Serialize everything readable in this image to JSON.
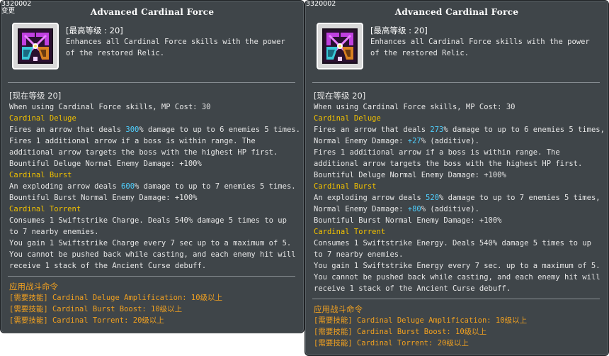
{
  "colors": {
    "panel_bg": "#3f4549",
    "text": "#e6e6e6",
    "section_heading": "#f0c000",
    "highlight_value": "#4fd0ff",
    "required_skill": "#f0a020"
  },
  "left": {
    "id_tag": "3320002",
    "change_tag": "变更",
    "title": "Advanced Cardinal Force",
    "icon": "cardinal-force-relic-icon",
    "max_level": "[最高等级 : 20]",
    "description": "Enhances all Cardinal Force skills with the power of the restored Relic.",
    "current_level": "[现在等级 20]",
    "mp_cost": "When using Cardinal Force skills, MP Cost: 30",
    "deluge_heading": "Cardinal Deluge",
    "deluge_pre": "Fires an arrow that deals ",
    "deluge_val": "300",
    "deluge_post": "% damage to up to 6 enemies 5 times.",
    "deluge_extra": "Fires 1 additional arrow if a boss is within range. The additional arrow targets the boss with the highest HP first.",
    "deluge_bountiful": "Bountiful Deluge Normal Enemy Damage: +100%",
    "burst_heading": "Cardinal Burst",
    "burst_pre": "An exploding arrow deals ",
    "burst_val": "600",
    "burst_post": "% damage to up to 7 enemies 5 times.",
    "burst_bountiful": "Bountiful Burst Normal Enemy Damage: +100%",
    "torrent_heading": "Cardinal Torrent",
    "torrent_consume": "Consumes 1 Swiftstrike Charge. Deals 540% damage 5 times to up to 7 nearby enemies.",
    "torrent_gain": "You gain 1 Swiftstrike Charge every 7 sec up to a maximum of 5.",
    "torrent_note": "You cannot be pushed back while casting, and each enemy hit will receive 1 stack of the Ancient Curse debuff.",
    "command_heading": "应用战斗命令",
    "req1": "[需要技能] Cardinal Deluge Amplification: 10级以上",
    "req2": "[需要技能] Cardinal Burst Boost: 10级以上",
    "req3": "[需要技能] Cardinal Torrent: 20级以上"
  },
  "right": {
    "id_tag": "3320002",
    "title": "Advanced Cardinal Force",
    "icon": "cardinal-force-relic-icon",
    "max_level": "[最高等级 : 20]",
    "description": "Enhances all Cardinal Force skills with the power of the restored Relic.",
    "current_level": "[现在等级 20]",
    "mp_cost": "When using Cardinal Force skills, MP Cost: 30",
    "deluge_heading": "Cardinal Deluge",
    "deluge_pre": "Fires an arrow that deals ",
    "deluge_val": "273",
    "deluge_post": "% damage to up to 6 enemies 5 times,",
    "deluge_normal_pre": "Normal Enemy Damage: ",
    "deluge_normal_val": "+27",
    "deluge_normal_post": "% (additive).",
    "deluge_extra": "Fires 1 additional arrow if a boss is within range. The additional arrow targets the boss with the highest HP first.",
    "deluge_bountiful": "Bountiful Deluge Normal Enemy Damage: +100%",
    "burst_heading": "Cardinal Burst",
    "burst_pre": "An exploding arrow deals ",
    "burst_val": "520",
    "burst_post": "% damage to up to 7 enemies 5 times,",
    "burst_normal_pre": "Normal Enemy Damage: ",
    "burst_normal_val": "+80",
    "burst_normal_post": "% (additive).",
    "burst_bountiful": "Bountiful Burst Normal Enemy Damage: +100%",
    "torrent_heading": "Cardinal Torrent",
    "torrent_consume": "Consumes 1 Swiftstrike Energy. Deals 540% damage 5 times to up to 7 nearby enemies.",
    "torrent_gain": "You gain 1 Swiftstrike Energy every 7 sec. up to a maximum of 5.",
    "torrent_note": "You cannot be pushed back while casting, and each enemy hit will receive 1 stack of the Ancient Curse debuff.",
    "command_heading": "应用战斗命令",
    "req1": "[需要技能] Cardinal Deluge Amplification: 10级以上",
    "req2": "[需要技能] Cardinal Burst Boost: 10级以上",
    "req3": "[需要技能] Cardinal Torrent: 20级以上"
  }
}
